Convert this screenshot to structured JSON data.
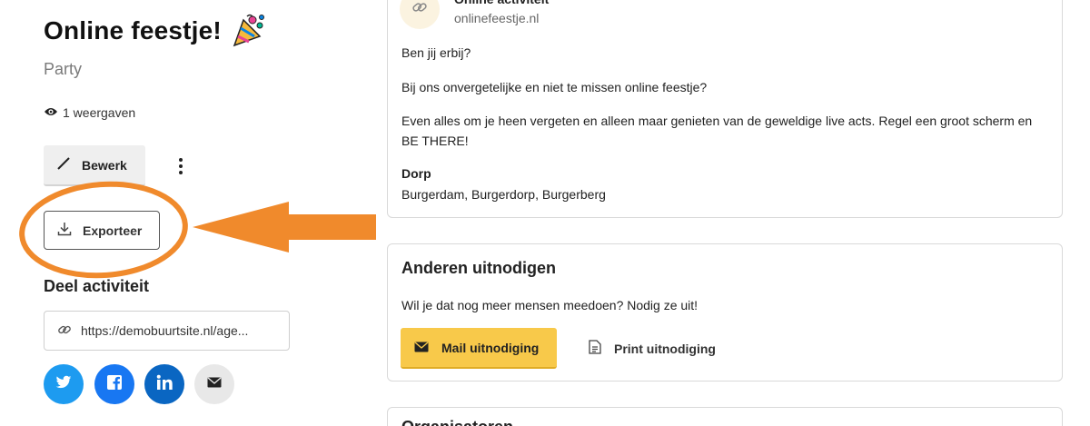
{
  "activity": {
    "title": "Online feestje!",
    "category": "Party",
    "views": "1 weergaven"
  },
  "actions": {
    "edit_label": "Bewerk",
    "export_label": "Exporteer"
  },
  "share": {
    "title": "Deel activiteit",
    "url": "https://demobuurtsite.nl/age..."
  },
  "details": {
    "type": "Online activiteit",
    "domain": "onlinefeestje.nl",
    "paragraphs": [
      "Ben jij erbij?",
      "Bij ons onvergetelijke en niet te missen online feestje?",
      "Even alles om je heen vergeten en alleen maar genieten van de geweldige live acts. Regel een groot scherm en BE THERE!"
    ],
    "dorp_label": "Dorp",
    "dorp_value": "Burgerdam, Burgerdorp, Burgerberg"
  },
  "invite": {
    "title": "Anderen uitnodigen",
    "text": "Wil je dat nog meer mensen meedoen? Nodig ze uit!",
    "mail_label": "Mail uitnodiging",
    "print_label": "Print uitnodiging"
  },
  "next_card": {
    "title": "Organisatoren"
  },
  "icons": {
    "party": "party-popper-icon",
    "views": "eye-icon",
    "edit": "pencil-icon",
    "more": "more-vertical-icon",
    "export": "download-icon",
    "link": "link-icon",
    "twitter": "twitter-icon",
    "facebook": "facebook-icon",
    "linkedin": "linkedin-icon",
    "email": "envelope-icon",
    "print": "document-icon"
  },
  "colors": {
    "accent_yellow": "#f8c94a",
    "annotation_orange": "#f08a2c",
    "twitter": "#1d9bf0",
    "facebook": "#1877f2",
    "linkedin": "#0a66c2",
    "email_bg": "#e8e8e8"
  }
}
